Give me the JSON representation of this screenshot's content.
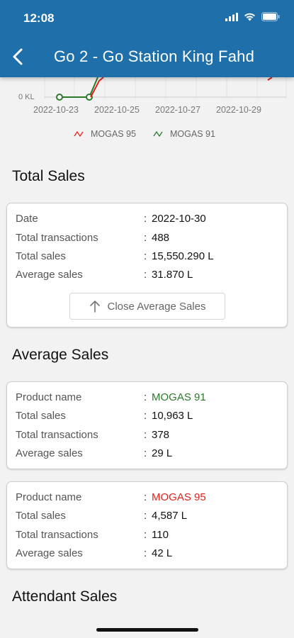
{
  "status_bar": {
    "time": "12:08",
    "wifi_icon": "wifi-icon",
    "battery_icon": "battery-icon"
  },
  "header": {
    "title": "Go 2 - Go Station King Fahd",
    "back_icon": "chevron-left-icon",
    "background": "#1f70aa"
  },
  "chart_data": {
    "type": "line",
    "x": [
      "2022-10-23",
      "2022-10-25",
      "2022-10-27",
      "2022-10-29"
    ],
    "y_label_visible": "0 KL",
    "series": [
      {
        "name": "MOGAS 95",
        "color": "#e0211c"
      },
      {
        "name": "MOGAS 91",
        "color": "#2a7a2a"
      }
    ],
    "xtick_labels": [
      "2022-10-23",
      "2022-10-25",
      "2022-10-27",
      "2022-10-29"
    ],
    "legend": [
      "MOGAS 95",
      "MOGAS 91"
    ]
  },
  "total_sales": {
    "title": "Total Sales",
    "rows": [
      {
        "label": "Date",
        "value": "2022-10-30"
      },
      {
        "label": "Total transactions",
        "value": "488"
      },
      {
        "label": "Total sales",
        "value": "15,550.290 L"
      },
      {
        "label": "Average sales",
        "value": "31.870 L"
      }
    ],
    "button_label": "Close Average Sales"
  },
  "average_sales": {
    "title": "Average Sales",
    "cards": [
      {
        "rows": [
          {
            "label": "Product name",
            "value": "MOGAS 91"
          },
          {
            "label": "Total sales",
            "value": "10,963 L"
          },
          {
            "label": "Total transactions",
            "value": "378"
          },
          {
            "label": "Average sales",
            "value": "29 L"
          }
        ]
      },
      {
        "rows": [
          {
            "label": "Product name",
            "value": "MOGAS 95"
          },
          {
            "label": "Total sales",
            "value": "4,587 L"
          },
          {
            "label": "Total transactions",
            "value": "110"
          },
          {
            "label": "Average sales",
            "value": "42 L"
          }
        ]
      }
    ]
  },
  "attendant_sales": {
    "title": "Attendant Sales"
  },
  "colon": ":"
}
